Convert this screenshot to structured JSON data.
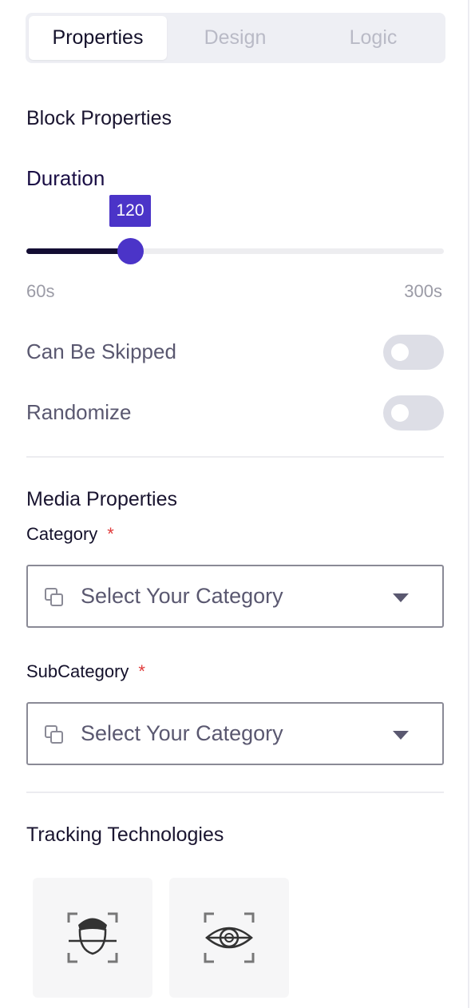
{
  "tabs": [
    {
      "label": "Properties",
      "active": true
    },
    {
      "label": "Design",
      "active": false
    },
    {
      "label": "Logic",
      "active": false
    }
  ],
  "block_properties": {
    "title": "Block Properties",
    "duration": {
      "label": "Duration",
      "value": "120",
      "value_fraction": 0.25,
      "min_label": "60s",
      "max_label": "300s"
    },
    "toggles": [
      {
        "label": "Can Be Skipped",
        "on": false
      },
      {
        "label": "Randomize",
        "on": false
      }
    ]
  },
  "media_properties": {
    "title": "Media Properties",
    "category": {
      "label": "Category",
      "required_mark": "*",
      "placeholder": "Select Your Category",
      "icon": "copy-icon"
    },
    "subcategory": {
      "label": "SubCategory",
      "required_mark": "*",
      "placeholder": "Select Your Category",
      "icon": "copy-icon"
    }
  },
  "tracking": {
    "title": "Tracking Technologies",
    "options": [
      {
        "icon": "face-tracking-icon"
      },
      {
        "icon": "eye-tracking-icon"
      }
    ]
  },
  "colors": {
    "accent": "#4b34c8",
    "track_fill": "#130d33",
    "required": "#e03b3b"
  }
}
